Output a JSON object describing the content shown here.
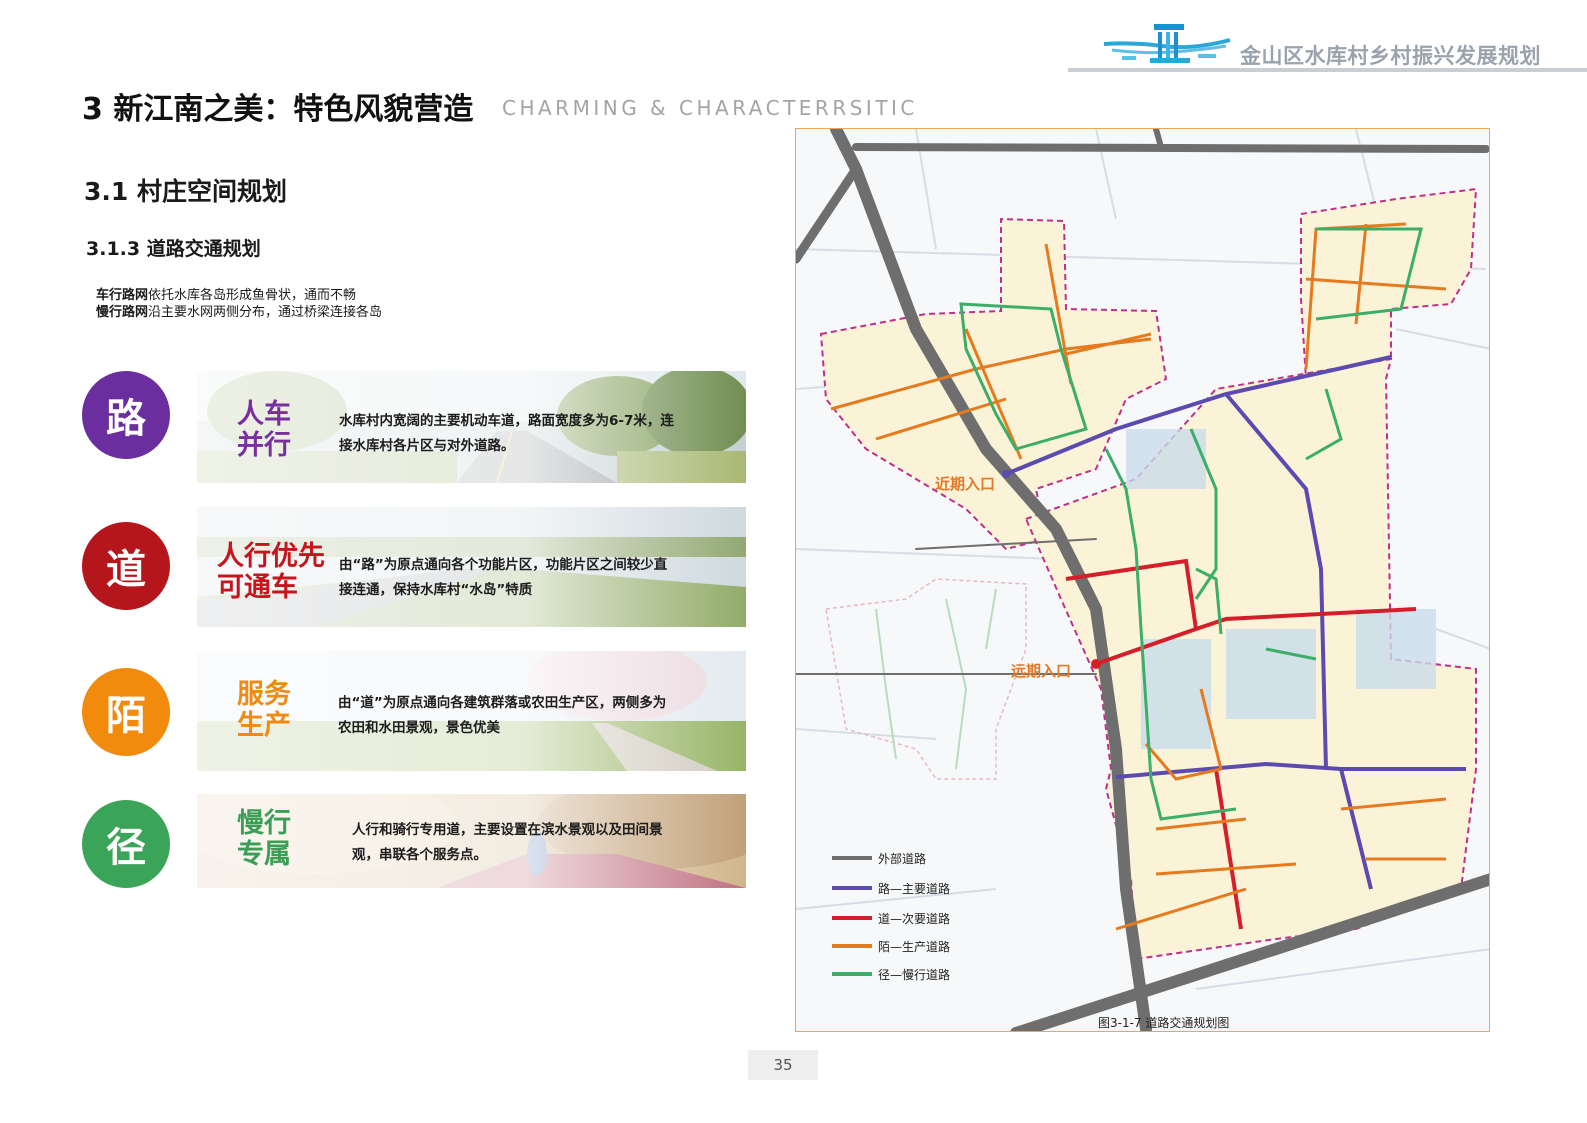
{
  "header": {
    "project_title": "金山区水库村乡村振兴发展规划",
    "page_title": "3 新江南之美：特色风貌营造",
    "page_subtitle": "CHARMING & CHARACTERRSITIC"
  },
  "section": {
    "title": "3.1 村庄空间规划",
    "subtitle": "3.1.3 道路交通规划"
  },
  "intro": [
    {
      "bold": "车行路网",
      "text": "依托水库各岛形成鱼骨状，通而不畅"
    },
    {
      "bold": "慢行路网",
      "text": "沿主要水网两侧分布，通过桥梁连接各岛"
    }
  ],
  "items": [
    {
      "char": "路",
      "color": "#6b2e9e",
      "title": "人车\n并行",
      "title_color": "#7a2fa0",
      "text": "水库村内宽阔的主要机动车道，路面宽度多为6-7米，连接水库村各片区与对外道路。"
    },
    {
      "char": "道",
      "color": "#b5161c",
      "title": "人行优先\n可通车",
      "title_color": "#c4161c",
      "text": "由“路”为原点通向各个功能片区，功能片区之间较少直接连通，保持水库村“水岛”特质"
    },
    {
      "char": "陌",
      "color": "#f28a0c",
      "title": "服务\n生产",
      "title_color": "#f08a12",
      "text": "由“道”为原点通向各建筑群落或农田生产区，两侧多为农田和水田景观，景色优美"
    },
    {
      "char": "径",
      "color": "#3aa458",
      "title": "慢行\n专属",
      "title_color": "#3a9e55",
      "text": "人行和骑行专用道，主要设置在滨水景观以及田间景观，串联各个服务点。"
    }
  ],
  "map": {
    "label_near": "近期入口",
    "label_far": "远期入口",
    "legend": [
      {
        "label": "外部道路",
        "color": "#6e6e6e"
      },
      {
        "label": "路—主要道路",
        "color": "#5b4bb0"
      },
      {
        "label": "道—次要道路",
        "color": "#d41f2a"
      },
      {
        "label": "陌—生产道路",
        "color": "#e67a1e"
      },
      {
        "label": "径—慢行道路",
        "color": "#3cae6a"
      }
    ],
    "caption": "图3-1-7 道路交通规划图"
  },
  "page_number": "35"
}
